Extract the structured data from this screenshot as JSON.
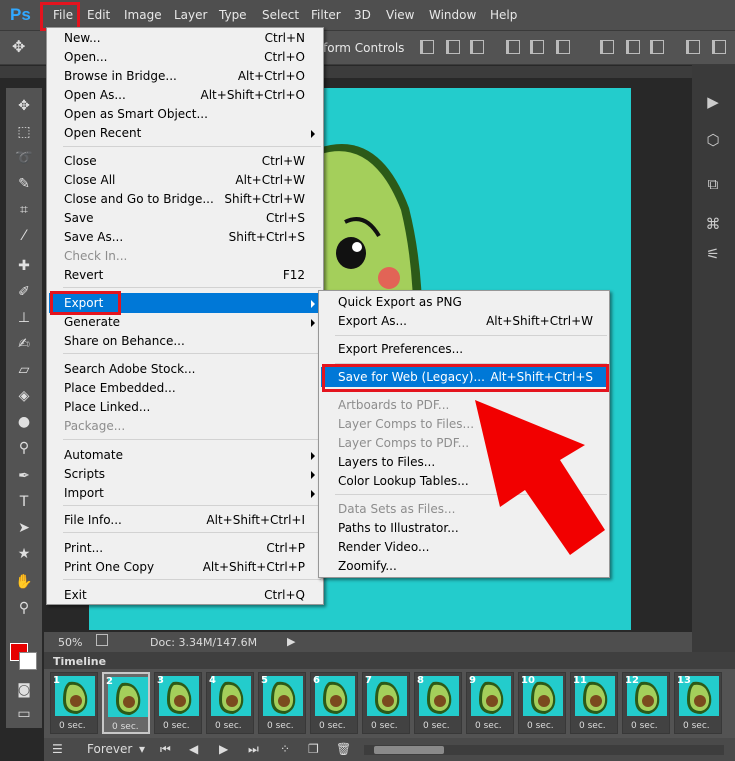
{
  "app": {
    "logo": "Ps"
  },
  "menubar": {
    "items": [
      "File",
      "Edit",
      "Image",
      "Layer",
      "Type",
      "Select",
      "Filter",
      "3D",
      "View",
      "Window",
      "Help"
    ]
  },
  "options_bar": {
    "transform_controls_label": "form Controls"
  },
  "status": {
    "zoom": "50%",
    "doc": "Doc: 3.34M/147.6M"
  },
  "timeline": {
    "title": "Timeline",
    "frames": [
      {
        "num": "1",
        "dur": "0 sec."
      },
      {
        "num": "2",
        "dur": "0 sec."
      },
      {
        "num": "3",
        "dur": "0 sec."
      },
      {
        "num": "4",
        "dur": "0 sec."
      },
      {
        "num": "5",
        "dur": "0 sec."
      },
      {
        "num": "6",
        "dur": "0 sec."
      },
      {
        "num": "7",
        "dur": "0 sec."
      },
      {
        "num": "8",
        "dur": "0 sec."
      },
      {
        "num": "9",
        "dur": "0 sec."
      },
      {
        "num": "10",
        "dur": "0 sec."
      },
      {
        "num": "11",
        "dur": "0 sec."
      },
      {
        "num": "12",
        "dur": "0 sec."
      },
      {
        "num": "13",
        "dur": "0 sec."
      }
    ],
    "loop": "Forever"
  },
  "file_menu": {
    "items": [
      {
        "label": "New...",
        "shortcut": "Ctrl+N"
      },
      {
        "label": "Open...",
        "shortcut": "Ctrl+O"
      },
      {
        "label": "Browse in Bridge...",
        "shortcut": "Alt+Ctrl+O"
      },
      {
        "label": "Open As...",
        "shortcut": "Alt+Shift+Ctrl+O"
      },
      {
        "label": "Open as Smart Object...",
        "shortcut": ""
      },
      {
        "label": "Open Recent",
        "shortcut": ""
      },
      {
        "label": "Close",
        "shortcut": "Ctrl+W"
      },
      {
        "label": "Close All",
        "shortcut": "Alt+Ctrl+W"
      },
      {
        "label": "Close and Go to Bridge...",
        "shortcut": "Shift+Ctrl+W"
      },
      {
        "label": "Save",
        "shortcut": "Ctrl+S"
      },
      {
        "label": "Save As...",
        "shortcut": "Shift+Ctrl+S"
      },
      {
        "label": "Check In...",
        "shortcut": ""
      },
      {
        "label": "Revert",
        "shortcut": "F12"
      },
      {
        "label": "Export",
        "shortcut": ""
      },
      {
        "label": "Generate",
        "shortcut": ""
      },
      {
        "label": "Share on Behance...",
        "shortcut": ""
      },
      {
        "label": "Search Adobe Stock...",
        "shortcut": ""
      },
      {
        "label": "Place Embedded...",
        "shortcut": ""
      },
      {
        "label": "Place Linked...",
        "shortcut": ""
      },
      {
        "label": "Package...",
        "shortcut": ""
      },
      {
        "label": "Automate",
        "shortcut": ""
      },
      {
        "label": "Scripts",
        "shortcut": ""
      },
      {
        "label": "Import",
        "shortcut": ""
      },
      {
        "label": "File Info...",
        "shortcut": "Alt+Shift+Ctrl+I"
      },
      {
        "label": "Print...",
        "shortcut": "Ctrl+P"
      },
      {
        "label": "Print One Copy",
        "shortcut": "Alt+Shift+Ctrl+P"
      },
      {
        "label": "Exit",
        "shortcut": "Ctrl+Q"
      }
    ]
  },
  "export_menu": {
    "items": [
      {
        "label": "Quick Export as PNG",
        "shortcut": ""
      },
      {
        "label": "Export As...",
        "shortcut": "Alt+Shift+Ctrl+W"
      },
      {
        "label": "Export Preferences...",
        "shortcut": ""
      },
      {
        "label": "Save for Web (Legacy)...",
        "shortcut": "Alt+Shift+Ctrl+S"
      },
      {
        "label": "Artboards to PDF...",
        "shortcut": ""
      },
      {
        "label": "Layer Comps to Files...",
        "shortcut": ""
      },
      {
        "label": "Layer Comps to PDF...",
        "shortcut": ""
      },
      {
        "label": "Layers to Files...",
        "shortcut": ""
      },
      {
        "label": "Color Lookup Tables...",
        "shortcut": ""
      },
      {
        "label": "Data Sets as Files...",
        "shortcut": ""
      },
      {
        "label": "Paths to Illustrator...",
        "shortcut": ""
      },
      {
        "label": "Render Video...",
        "shortcut": ""
      },
      {
        "label": "Zoomify...",
        "shortcut": ""
      }
    ]
  },
  "colors": {
    "highlight": "#0078d7",
    "annotation": "#e4141e",
    "canvas": "#23cccc",
    "foreground": "#e60000"
  }
}
